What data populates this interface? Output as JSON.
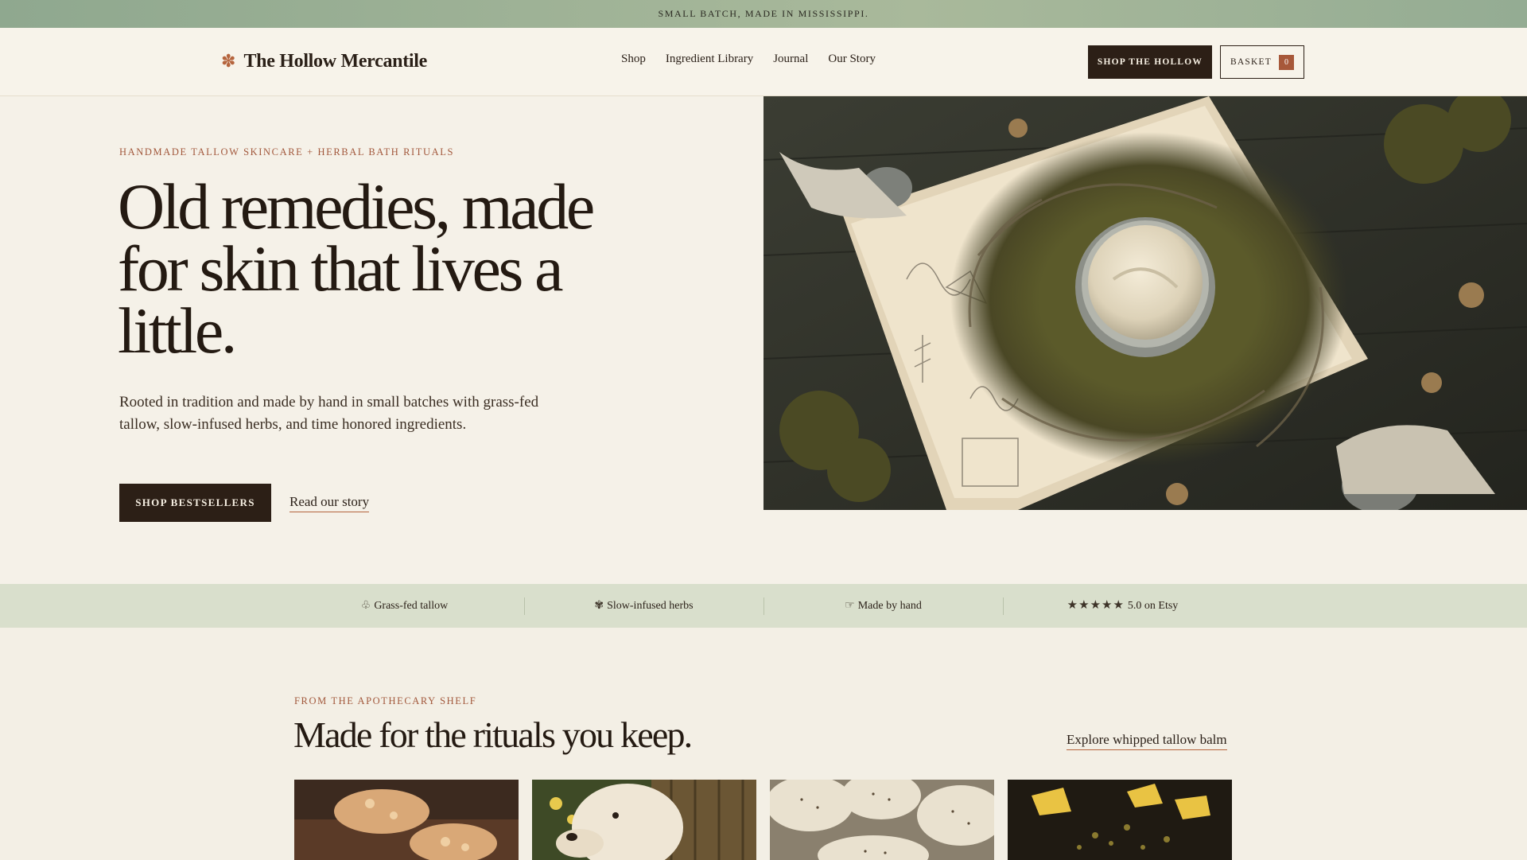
{
  "announcement": "SMALL BATCH, MADE IN MISSISSIPPI.",
  "nav": {
    "brand": "The Hollow Mercantile",
    "brand_icon": "leaf-icon",
    "links": [
      "Shop",
      "Ingredient Library",
      "Journal",
      "Our Story"
    ],
    "shop_button": "SHOP THE HOLLOW",
    "basket_label": "BASKET",
    "basket_count": "0"
  },
  "hero": {
    "eyebrow": "HANDMADE TALLOW SKINCARE + HERBAL BATH RITUALS",
    "headline": "Old remedies, made for skin that lives a little.",
    "intro": "Rooted in tradition and made by hand in small batches with grass-fed tallow, slow-infused herbs, and time honored ingredients.",
    "primary_button": "SHOP BESTSELLERS",
    "secondary_link": "Read our story",
    "image": "tallow-balm-jar-in-moss-nest-on-herbal-manuscript"
  },
  "trust_bar": [
    {
      "icon": "cow-icon",
      "glyph": "♧",
      "label": "Grass-fed tallow"
    },
    {
      "icon": "herb-icon",
      "glyph": "✾",
      "label": "Slow-infused herbs"
    },
    {
      "icon": "hand-icon",
      "glyph": "☞",
      "label": "Made by hand"
    },
    {
      "icon": "star-rating-icon",
      "glyph": "★★★★★",
      "label": "5.0 on Etsy"
    }
  ],
  "shelf": {
    "eyebrow": "FROM THE APOTHECARY SHELF",
    "title": "Made for the rituals you keep.",
    "link": "Explore whipped tallow balm",
    "cards": [
      {
        "image": "herbal-bath-soak"
      },
      {
        "image": "golden-retriever-puppy"
      },
      {
        "image": "tallow-soap-bars"
      },
      {
        "image": "beeswax-and-herbs"
      }
    ]
  },
  "colors": {
    "accent": "#a2583c",
    "dark": "#2c1f16",
    "cream": "#f5f1e8",
    "sage": "#d9dfcc"
  }
}
